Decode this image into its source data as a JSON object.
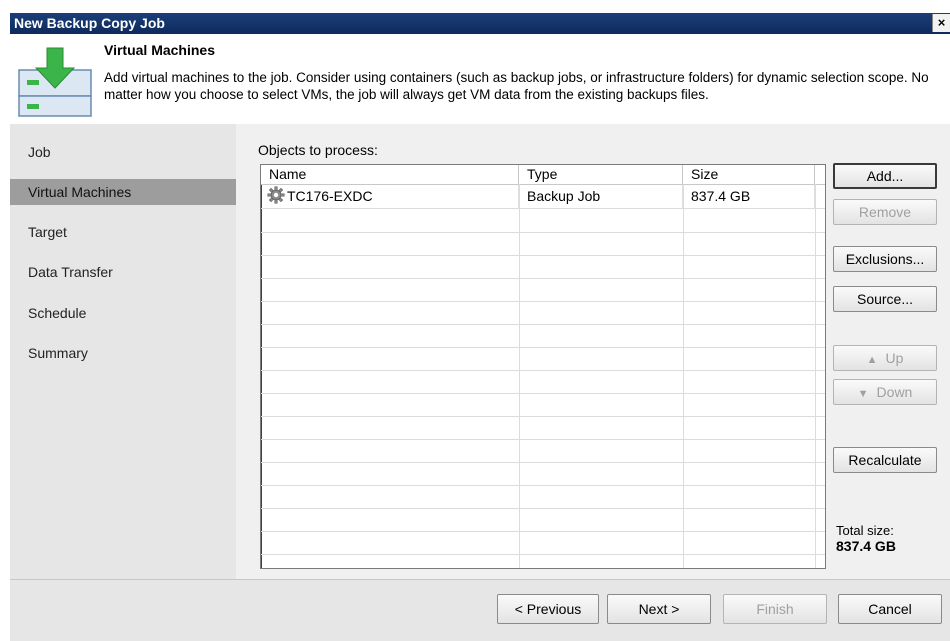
{
  "window": {
    "title": "New Backup Copy Job",
    "close_label": "×"
  },
  "header": {
    "title": "Virtual Machines",
    "description": "Add virtual machines to the job. Consider using containers (such as backup jobs, or infrastructure folders) for dynamic selection scope. No matter how you choose to select VMs, the job will always get VM data from the existing backups files.",
    "icon": "vm-download-icon"
  },
  "nav": {
    "items": [
      {
        "label": "Job"
      },
      {
        "label": "Virtual Machines",
        "active": true
      },
      {
        "label": "Target"
      },
      {
        "label": "Data Transfer"
      },
      {
        "label": "Schedule"
      },
      {
        "label": "Summary"
      }
    ]
  },
  "objects": {
    "label": "Objects to process:",
    "columns": [
      "Name",
      "Type",
      "Size"
    ],
    "rows": [
      {
        "name": "TC176-EXDC",
        "type": "Backup Job",
        "size": "837.4 GB",
        "icon": "gear-icon"
      }
    ]
  },
  "side_buttons": {
    "add": "Add...",
    "remove": "Remove",
    "exclusions": "Exclusions...",
    "source": "Source...",
    "up": "Up",
    "down": "Down",
    "recalculate": "Recalculate"
  },
  "total": {
    "label": "Total size:",
    "value": "837.4 GB"
  },
  "footer": {
    "previous": "< Previous",
    "next": "Next >",
    "finish": "Finish",
    "cancel": "Cancel"
  },
  "colors": {
    "titlebar": "#0e2a5c",
    "nav_active": "#9d9d9d",
    "icon_green": "#3bb54a"
  }
}
